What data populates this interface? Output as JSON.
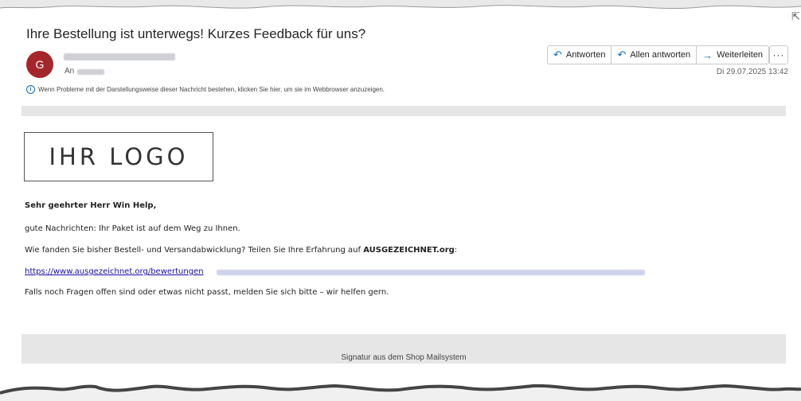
{
  "email": {
    "subject": "Ihre Bestellung ist unterwegs! Kurzes Feedback für uns?",
    "sender_initial": "G",
    "to_label": "An",
    "date": "Di 29.07.2025 13:42",
    "info_notice": "Wenn Probleme mit der Darstellungsweise dieser Nachricht bestehen, klicken Sie hier, um sie im Webbrowser anzuzeigen."
  },
  "actions": {
    "reply": "Antworten",
    "reply_all": "Allen antworten",
    "forward": "Weiterleiten",
    "more": "···"
  },
  "body": {
    "logo_text": "IHR LOGO",
    "greeting": "Sehr geehrter Herr Win Help,",
    "line1": "gute Nachrichten: Ihr Paket ist auf dem Weg zu Ihnen.",
    "line2_prefix": "Wie fanden Sie bisher Bestell- und Versandabwicklung? Teilen Sie Ihre Erfahrung auf ",
    "line2_brand": "AUSGEZEICHNET.org",
    "line2_suffix": ":",
    "link_text": "https://www.ausgezeichnet.org/bewertungen",
    "line3": "Falls noch Fragen offen sind oder etwas nicht passt, melden Sie sich bitte – wir helfen gern.",
    "signature": "Signatur aus dem Shop Mailsystem"
  },
  "colors": {
    "avatar_bg": "#a4262c",
    "accent": "#0f6cbd",
    "link": "#1a0dab"
  },
  "icons": {
    "reply": "reply-arrow-icon",
    "reply_all": "reply-all-arrow-icon",
    "forward": "forward-arrow-icon",
    "info": "info-icon"
  }
}
